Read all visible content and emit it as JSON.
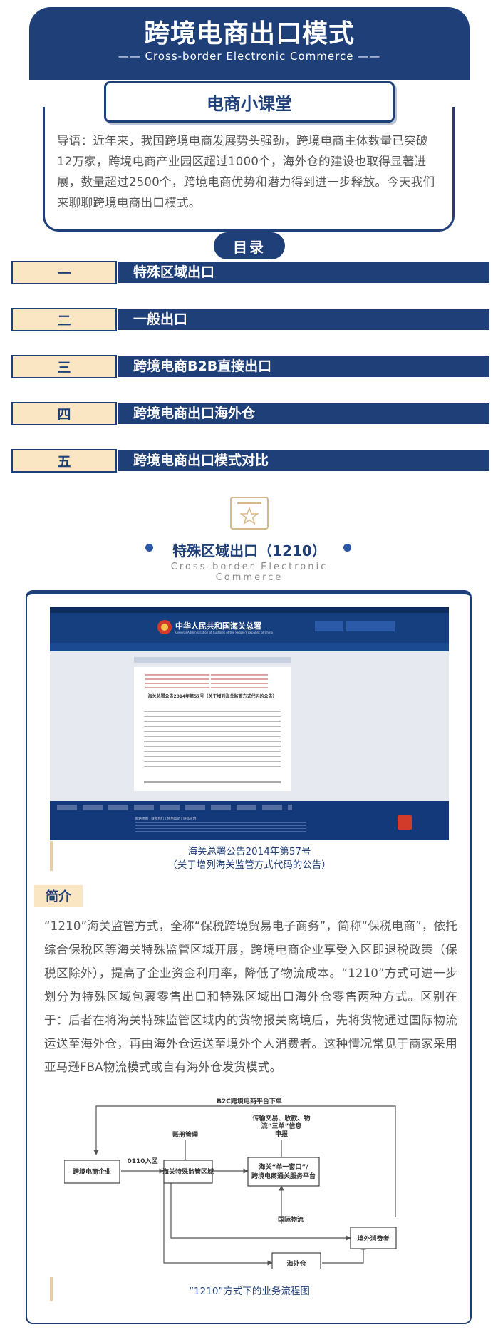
{
  "header": {
    "title": "跨境电商出口模式",
    "subtitle": "—— Cross-border Electronic Commerce ——",
    "badge": "电商小课堂"
  },
  "intro": "导语：近年来，我国跨境电商发展势头强劲，跨境电商主体数量已突破12万家，跨境电商产业园区超过1000个，海外仓的建设也取得显著进展，数量超过2500个，跨境电商优势和潜力得到进一步释放。今天我们来聊聊跨境电商出口模式。",
  "toc": {
    "title": "目录",
    "items": [
      {
        "num": "一",
        "label": "特殊区域出口"
      },
      {
        "num": "二",
        "label": "一般出口"
      },
      {
        "num": "三",
        "label": "跨境电商B2B直接出口"
      },
      {
        "num": "四",
        "label": "跨境电商出口海外仓"
      },
      {
        "num": "五",
        "label": "跨境电商出口模式对比"
      }
    ]
  },
  "section": {
    "title": "特殊区域出口（1210）",
    "subtitle": "Cross-border Electronic Commerce"
  },
  "website": {
    "org_name": "中华人民共和国海关总署",
    "org_en": "General Administration of Customs of the People's Republic of China",
    "announcement_title": "海关总署公告2014年第57号（关于增列海关监管方式代码的公告）",
    "footer_links": "网站地图  |  联系我们  |  使用帮助  |  隐私声明"
  },
  "caption": {
    "line1": "海关总署公告2014年第57号",
    "line2": "（关于增列海关监管方式代码的公告）"
  },
  "intro_label": "简介",
  "body": "“1210”海关监管方式，全称“保税跨境贸易电子商务”，简称“保税电商”，依托综合保税区等海关特殊监管区域开展，跨境电商企业享受入区即退税政策（保税区除外），提高了企业资金利用率，降低了物流成本。“1210”方式可进一步划分为特殊区域包裹零售出口和特殊区域出口海外仓零售两种方式。区别在于：后者在将海关特殊监管区域内的货物报关离境后，先将货物通过国际物流运送至海外仓，再由海外仓运送至境外个人消费者。这种情况常见于商家采用亚马逊FBA物流模式或自有海外仓发货模式。",
  "flow": {
    "top_label": "B2C跨境电商平台下单",
    "account_mgmt": "账册管理",
    "info_label_1": "传输交易、收款、物",
    "info_label_2": "流“三单”信息",
    "info_label_3": "申报",
    "entry_label": "0110入区",
    "node_enterprise": "跨境电商企业",
    "node_zone": "海关特殊监管区域",
    "node_window_1": "海关“单一窗口”/",
    "node_window_2": "跨境电商通关服务平台",
    "intl_logistics": "国际物流",
    "node_consumer": "境外消费者",
    "node_warehouse": "海外仓",
    "caption": "“1210”方式下的业务流程图"
  }
}
